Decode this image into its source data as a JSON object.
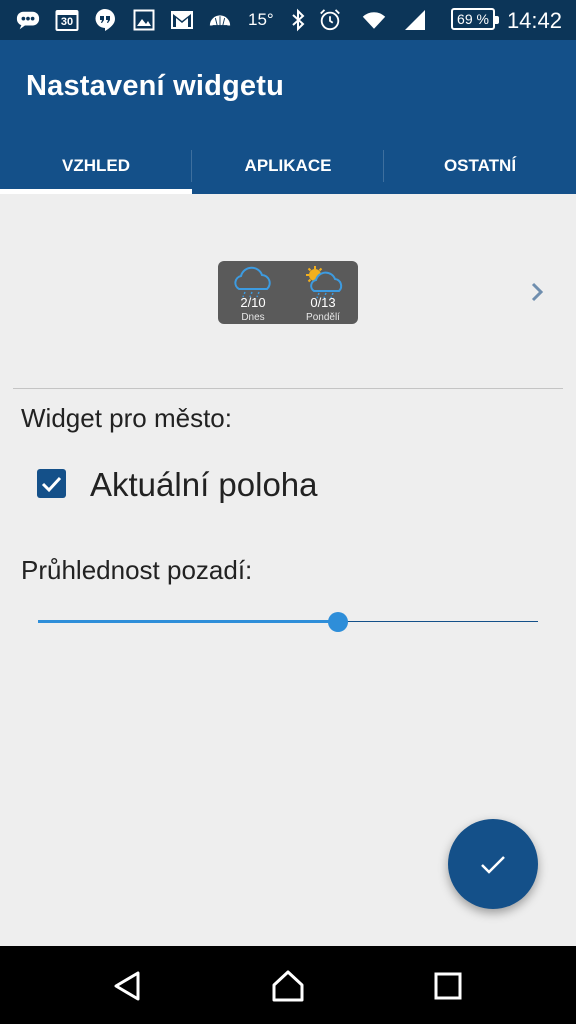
{
  "status_bar": {
    "calendar_day": "30",
    "temperature": "15°",
    "battery": "69 %",
    "time": "14:42",
    "icons": [
      "chat-icon",
      "calendar-icon",
      "hangouts-icon",
      "image-icon",
      "gmail-icon",
      "weather-icon",
      "bluetooth-icon",
      "alarm-icon",
      "wifi-icon",
      "signal-icon",
      "battery-icon"
    ]
  },
  "app_bar": {
    "title": "Nastavení widgetu",
    "tabs": [
      {
        "label": "VZHLED",
        "selected": true
      },
      {
        "label": "APLIKACE",
        "selected": false
      },
      {
        "label": "OSTATNÍ",
        "selected": false
      }
    ]
  },
  "widget_preview": {
    "days": [
      {
        "temp": "2/10",
        "label": "Dnes",
        "icon": "cloud-rain-icon"
      },
      {
        "temp": "0/13",
        "label": "Pondělí",
        "icon": "sun-cloud-rain-icon"
      }
    ]
  },
  "settings": {
    "city_label": "Widget pro město:",
    "current_location_label": "Aktuální poloha",
    "current_location_checked": true,
    "opacity_label": "Průhlednost pozadí:",
    "opacity_value": 0.6
  },
  "colors": {
    "status_bar": "#0c3558",
    "primary": "#145089",
    "accent": "#2e8ed9",
    "background": "#eeeeee"
  }
}
